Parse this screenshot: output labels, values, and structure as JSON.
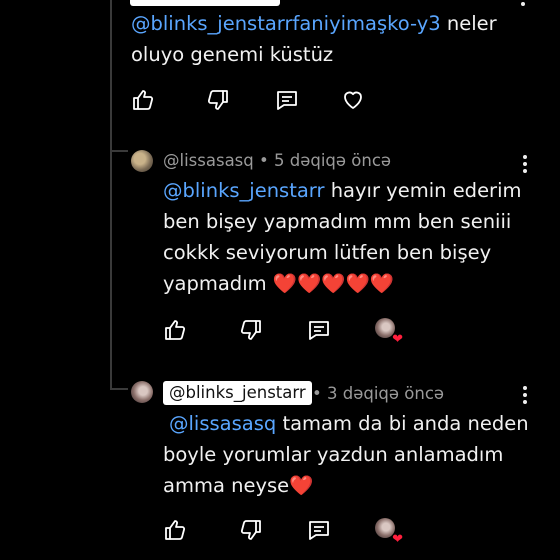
{
  "comment_top": {
    "mention": "@blinks_jenstarrfaniyimaşko-y3",
    "text_line1_rest": " neler",
    "text_line2": "oluyo genemi küstüz"
  },
  "comment_reply1": {
    "author": "@lissasasq",
    "time": " • 5 dəqiqə öncə",
    "mention": "@blinks_jenstarr",
    "text_line1_rest": " hayır yemin ederim",
    "text_line2": "ben bişey yapmadım mm ben seniii",
    "text_line3": "cokkk seviyorum lütfen ben bişey",
    "text_line4": "yapmadım ❤️❤️❤️❤️❤️"
  },
  "comment_reply2": {
    "author_badge": "@blinks_jenstarr",
    "time": " • 3 dəqiqə öncə",
    "mention": "@lissasasq",
    "text_line1_rest": " tamam da bi anda neden",
    "text_line2": "boyle yorumlar yazdun anlamadım",
    "text_line3": "amma neyse❤️"
  },
  "colors": {
    "background": "#000000",
    "text": "#f1f1f1",
    "mention": "#5aa6ff",
    "meta": "#9a9a9a",
    "heart": "#ff1f3d"
  },
  "icons": [
    "like-icon",
    "dislike-icon",
    "reply-icon",
    "heart-icon",
    "more-options-icon"
  ]
}
